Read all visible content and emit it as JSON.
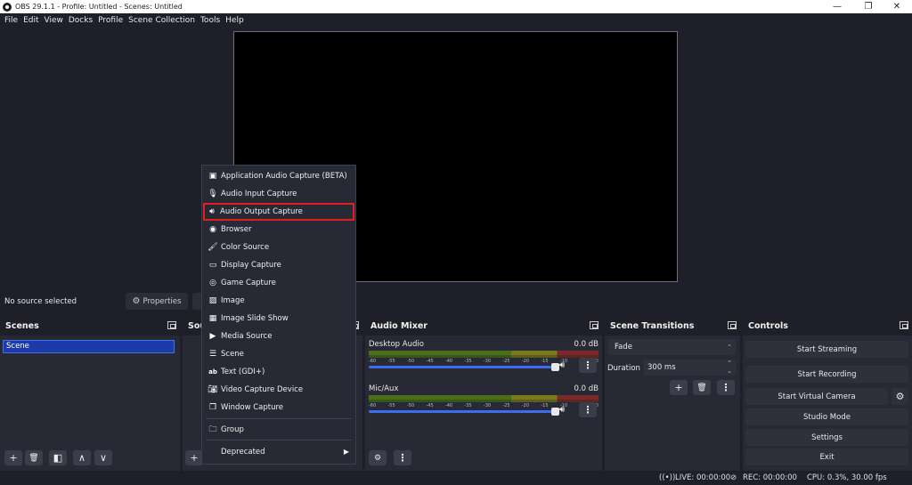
{
  "titlebar": {
    "title": "OBS 29.1.1 - Profile: Untitled - Scenes: Untitled",
    "minimize": "—",
    "restore": "❐",
    "close": "✕"
  },
  "menu": [
    "File",
    "Edit",
    "View",
    "Docks",
    "Profile",
    "Scene Collection",
    "Tools",
    "Help"
  ],
  "source_bar": {
    "no_source": "No source selected",
    "properties": "Properties",
    "properties_icon": "gear-icon"
  },
  "scenes": {
    "title": "Scenes",
    "items": [
      "Scene"
    ],
    "buttons": {
      "add": "+",
      "remove": "🗑",
      "filter": "◧",
      "up": "∧",
      "down": "∨"
    }
  },
  "sources": {
    "title": "Sou",
    "add": "+"
  },
  "audio_mixer": {
    "title": "Audio Mixer",
    "ticks": [
      "-60",
      "-55",
      "-50",
      "-45",
      "-40",
      "-35",
      "-30",
      "-25",
      "-20",
      "-15",
      "-10",
      "-5",
      "0"
    ],
    "channels": [
      {
        "name": "Desktop Audio",
        "db": "0.0 dB",
        "volume": 1.0
      },
      {
        "name": "Mic/Aux",
        "db": "0.0 dB",
        "volume": 1.0
      }
    ],
    "buttons": {
      "settings": "⚙",
      "menu": "⋮"
    }
  },
  "scene_transitions": {
    "title": "Scene Transitions",
    "transition": "Fade",
    "duration_label": "Duration",
    "duration_value": "300 ms",
    "buttons": {
      "add": "+",
      "remove": "🗑",
      "menu": "⋮"
    }
  },
  "controls": {
    "title": "Controls",
    "start_streaming": "Start Streaming",
    "start_recording": "Start Recording",
    "start_virtual_camera": "Start Virtual Camera",
    "studio_mode": "Studio Mode",
    "settings": "Settings",
    "exit": "Exit"
  },
  "status": {
    "live": "LIVE: 00:00:00",
    "rec": "REC: 00:00:00",
    "cpu": "CPU: 0.3%, 30.00 fps"
  },
  "context_menu": {
    "highlight_color": "#e02020",
    "items": [
      {
        "label": "Application Audio Capture (BETA)",
        "icon": "app-audio-icon"
      },
      {
        "label": "Audio Input Capture",
        "icon": "microphone-icon"
      },
      {
        "label": "Audio Output Capture",
        "icon": "speaker-icon",
        "highlighted": true
      },
      {
        "label": "Browser",
        "icon": "globe-icon"
      },
      {
        "label": "Color Source",
        "icon": "brush-icon"
      },
      {
        "label": "Display Capture",
        "icon": "monitor-icon"
      },
      {
        "label": "Game Capture",
        "icon": "gamepad-icon"
      },
      {
        "label": "Image",
        "icon": "image-icon"
      },
      {
        "label": "Image Slide Show",
        "icon": "slideshow-icon"
      },
      {
        "label": "Media Source",
        "icon": "play-icon"
      },
      {
        "label": "Scene",
        "icon": "list-icon"
      },
      {
        "label": "Text (GDI+)",
        "icon": "text-icon"
      },
      {
        "label": "Video Capture Device",
        "icon": "camera-icon"
      },
      {
        "label": "Window Capture",
        "icon": "window-icon"
      },
      {
        "label": "Group",
        "icon": "folder-icon"
      },
      {
        "label": "Deprecated",
        "icon": "",
        "submenu": true
      }
    ]
  }
}
